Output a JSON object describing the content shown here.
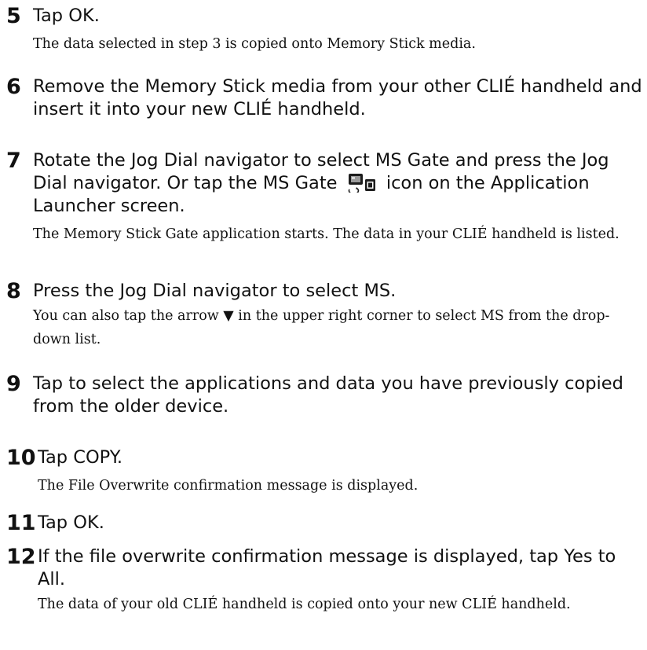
{
  "steps": [
    {
      "number": "5",
      "instruction": "Tap OK.",
      "result": "The data selected in step 3 is copied onto Memory Stick media."
    },
    {
      "number": "6",
      "instruction": "Remove the Memory Stick media from your other CLIÉ handheld and insert it into your new CLIÉ handheld."
    },
    {
      "number": "7",
      "instruction_before_icon": "Rotate the Jog Dial navigator to select MS Gate and press the Jog Dial navigator. Or tap the MS Gate",
      "icon": "ms-gate-icon",
      "instruction_after_icon": "icon on the Application Launcher screen.",
      "result": "The Memory Stick Gate application starts. The data in your CLIÉ handheld is listed."
    },
    {
      "number": "8",
      "instruction": "Press the Jog Dial navigator to select MS.",
      "result": "You can also tap the arrow ▼ in the upper right corner to select MS from the drop-down list."
    },
    {
      "number": "9",
      "instruction": "Tap to select the applications and data you have previously copied from the older device."
    },
    {
      "number": "10",
      "instruction": "Tap COPY.",
      "result": "The File Overwrite confirmation message is displayed."
    },
    {
      "number": "11",
      "instruction": "Tap OK."
    },
    {
      "number": "12",
      "instruction": "If the file overwrite confirmation message is displayed, tap Yes to All.",
      "result": "The data of your old CLIÉ handheld is copied onto your new CLIÉ handheld."
    }
  ]
}
